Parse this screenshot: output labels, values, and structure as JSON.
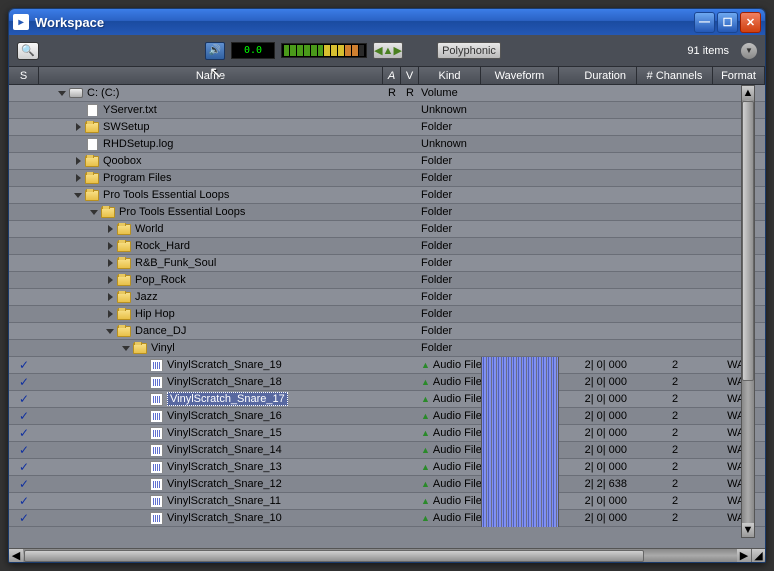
{
  "window": {
    "title": "Workspace"
  },
  "toolbar": {
    "counter": "0.0",
    "poly_label": "Polyphonic",
    "item_count": "91 items"
  },
  "cols": {
    "s": "S",
    "name": "Name",
    "a": "A",
    "v": "V",
    "kind": "Kind",
    "wave": "Waveform",
    "dur": "Duration",
    "ch": "# Channels",
    "fmt": "Format"
  },
  "rows": [
    {
      "check": false,
      "indent": 1,
      "disc": "down",
      "icon": "drive",
      "name": "C: (C:)",
      "a": "R",
      "v": "R",
      "kind": "Volume",
      "wave": false,
      "dur": "",
      "ch": "",
      "fmt": ""
    },
    {
      "check": false,
      "indent": 2,
      "disc": "none",
      "icon": "file",
      "name": "YServer.txt",
      "a": "",
      "v": "",
      "kind": "Unknown",
      "wave": false,
      "dur": "",
      "ch": "",
      "fmt": ""
    },
    {
      "check": false,
      "indent": 2,
      "disc": "right",
      "icon": "folder",
      "name": "SWSetup",
      "a": "",
      "v": "",
      "kind": "Folder",
      "wave": false,
      "dur": "",
      "ch": "",
      "fmt": ""
    },
    {
      "check": false,
      "indent": 2,
      "disc": "none",
      "icon": "file",
      "name": "RHDSetup.log",
      "a": "",
      "v": "",
      "kind": "Unknown",
      "wave": false,
      "dur": "",
      "ch": "",
      "fmt": ""
    },
    {
      "check": false,
      "indent": 2,
      "disc": "right",
      "icon": "folder",
      "name": "Qoobox",
      "a": "",
      "v": "",
      "kind": "Folder",
      "wave": false,
      "dur": "",
      "ch": "",
      "fmt": ""
    },
    {
      "check": false,
      "indent": 2,
      "disc": "right",
      "icon": "folder",
      "name": "Program Files",
      "a": "",
      "v": "",
      "kind": "Folder",
      "wave": false,
      "dur": "",
      "ch": "",
      "fmt": ""
    },
    {
      "check": false,
      "indent": 2,
      "disc": "down",
      "icon": "folder",
      "name": "Pro Tools Essential Loops",
      "a": "",
      "v": "",
      "kind": "Folder",
      "wave": false,
      "dur": "",
      "ch": "",
      "fmt": ""
    },
    {
      "check": false,
      "indent": 3,
      "disc": "down",
      "icon": "folder",
      "name": "Pro Tools Essential Loops",
      "a": "",
      "v": "",
      "kind": "Folder",
      "wave": false,
      "dur": "",
      "ch": "",
      "fmt": ""
    },
    {
      "check": false,
      "indent": 4,
      "disc": "right",
      "icon": "folder",
      "name": "World",
      "a": "",
      "v": "",
      "kind": "Folder",
      "wave": false,
      "dur": "",
      "ch": "",
      "fmt": ""
    },
    {
      "check": false,
      "indent": 4,
      "disc": "right",
      "icon": "folder",
      "name": "Rock_Hard",
      "a": "",
      "v": "",
      "kind": "Folder",
      "wave": false,
      "dur": "",
      "ch": "",
      "fmt": ""
    },
    {
      "check": false,
      "indent": 4,
      "disc": "right",
      "icon": "folder",
      "name": "R&B_Funk_Soul",
      "a": "",
      "v": "",
      "kind": "Folder",
      "wave": false,
      "dur": "",
      "ch": "",
      "fmt": ""
    },
    {
      "check": false,
      "indent": 4,
      "disc": "right",
      "icon": "folder",
      "name": "Pop_Rock",
      "a": "",
      "v": "",
      "kind": "Folder",
      "wave": false,
      "dur": "",
      "ch": "",
      "fmt": ""
    },
    {
      "check": false,
      "indent": 4,
      "disc": "right",
      "icon": "folder",
      "name": "Jazz",
      "a": "",
      "v": "",
      "kind": "Folder",
      "wave": false,
      "dur": "",
      "ch": "",
      "fmt": ""
    },
    {
      "check": false,
      "indent": 4,
      "disc": "right",
      "icon": "folder",
      "name": "Hip Hop",
      "a": "",
      "v": "",
      "kind": "Folder",
      "wave": false,
      "dur": "",
      "ch": "",
      "fmt": ""
    },
    {
      "check": false,
      "indent": 4,
      "disc": "down",
      "icon": "folder",
      "name": "Dance_DJ",
      "a": "",
      "v": "",
      "kind": "Folder",
      "wave": false,
      "dur": "",
      "ch": "",
      "fmt": ""
    },
    {
      "check": false,
      "indent": 5,
      "disc": "down",
      "icon": "folder",
      "name": "Vinyl",
      "a": "",
      "v": "",
      "kind": "Folder",
      "wave": false,
      "dur": "",
      "ch": "",
      "fmt": ""
    },
    {
      "check": true,
      "indent": 6,
      "disc": "none",
      "icon": "audio",
      "name": "VinylScratch_Snare_19",
      "a": "",
      "v": "",
      "kind": "Audio File",
      "kindicon": true,
      "wave": true,
      "dur": "2| 0| 000",
      "ch": "2",
      "fmt": "WAV"
    },
    {
      "check": true,
      "indent": 6,
      "disc": "none",
      "icon": "audio",
      "name": "VinylScratch_Snare_18",
      "a": "",
      "v": "",
      "kind": "Audio File",
      "kindicon": true,
      "wave": true,
      "dur": "2| 0| 000",
      "ch": "2",
      "fmt": "WAV"
    },
    {
      "check": true,
      "indent": 6,
      "disc": "none",
      "icon": "audio",
      "name": "VinylScratch_Snare_17",
      "a": "",
      "v": "",
      "kind": "Audio File",
      "kindicon": true,
      "wave": true,
      "selected": true,
      "playing": true,
      "dur": "2| 0| 000",
      "ch": "2",
      "fmt": "WAV"
    },
    {
      "check": true,
      "indent": 6,
      "disc": "none",
      "icon": "audio",
      "name": "VinylScratch_Snare_16",
      "a": "",
      "v": "",
      "kind": "Audio File",
      "kindicon": true,
      "wave": true,
      "dur": "2| 0| 000",
      "ch": "2",
      "fmt": "WAV"
    },
    {
      "check": true,
      "indent": 6,
      "disc": "none",
      "icon": "audio",
      "name": "VinylScratch_Snare_15",
      "a": "",
      "v": "",
      "kind": "Audio File",
      "kindicon": true,
      "wave": true,
      "dur": "2| 0| 000",
      "ch": "2",
      "fmt": "WAV"
    },
    {
      "check": true,
      "indent": 6,
      "disc": "none",
      "icon": "audio",
      "name": "VinylScratch_Snare_14",
      "a": "",
      "v": "",
      "kind": "Audio File",
      "kindicon": true,
      "wave": true,
      "dur": "2| 0| 000",
      "ch": "2",
      "fmt": "WAV"
    },
    {
      "check": true,
      "indent": 6,
      "disc": "none",
      "icon": "audio",
      "name": "VinylScratch_Snare_13",
      "a": "",
      "v": "",
      "kind": "Audio File",
      "kindicon": true,
      "wave": true,
      "dur": "2| 0| 000",
      "ch": "2",
      "fmt": "WAV"
    },
    {
      "check": true,
      "indent": 6,
      "disc": "none",
      "icon": "audio",
      "name": "VinylScratch_Snare_12",
      "a": "",
      "v": "",
      "kind": "Audio File",
      "kindicon": true,
      "wave": true,
      "dur": "2| 2| 638",
      "ch": "2",
      "fmt": "WAV"
    },
    {
      "check": true,
      "indent": 6,
      "disc": "none",
      "icon": "audio",
      "name": "VinylScratch_Snare_11",
      "a": "",
      "v": "",
      "kind": "Audio File",
      "kindicon": true,
      "wave": true,
      "dur": "2| 0| 000",
      "ch": "2",
      "fmt": "WAV"
    },
    {
      "check": true,
      "indent": 6,
      "disc": "none",
      "icon": "audio",
      "name": "VinylScratch_Snare_10",
      "a": "",
      "v": "",
      "kind": "Audio File",
      "kindicon": true,
      "wave": true,
      "dur": "2| 0| 000",
      "ch": "2",
      "fmt": "WAV"
    }
  ]
}
